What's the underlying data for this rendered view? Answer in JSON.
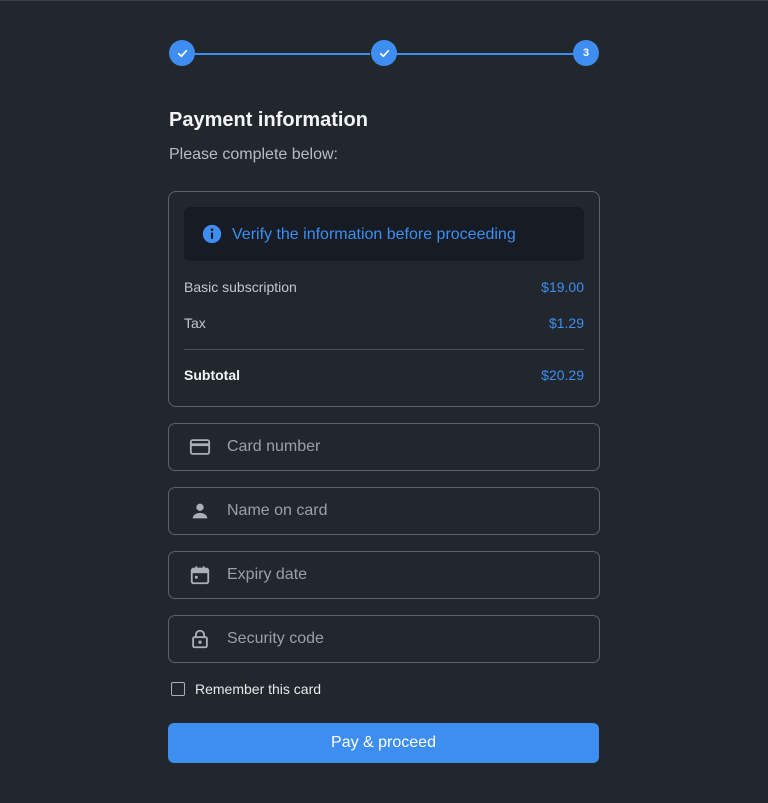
{
  "stepper": {
    "steps": [
      {
        "state": "complete",
        "icon": "check-icon"
      },
      {
        "state": "complete",
        "icon": "check-icon"
      },
      {
        "state": "current",
        "label": "3"
      }
    ]
  },
  "title": "Payment information",
  "subtitle": "Please complete below:",
  "alert": {
    "icon": "info-icon",
    "text": "Verify the information before proceeding"
  },
  "summary": {
    "rows": [
      {
        "label": "Basic subscription",
        "amount": "$19.00"
      },
      {
        "label": "Tax",
        "amount": "$1.29"
      }
    ],
    "subtotal": {
      "label": "Subtotal",
      "amount": "$20.29"
    }
  },
  "fields": {
    "card_number": {
      "icon": "credit-card-icon",
      "placeholder": "Card number",
      "value": ""
    },
    "name_on_card": {
      "icon": "person-icon",
      "placeholder": "Name on card",
      "value": ""
    },
    "expiry_date": {
      "icon": "calendar-icon",
      "placeholder": "Expiry date",
      "value": ""
    },
    "security_code": {
      "icon": "lock-icon",
      "placeholder": "Security code",
      "value": ""
    }
  },
  "remember": {
    "label": "Remember this card",
    "checked": false
  },
  "pay_button": {
    "label": "Pay & proceed"
  },
  "colors": {
    "background": "#22272e",
    "accent": "#3d8ef0",
    "border": "#5b616b",
    "alert_background": "#161b24"
  }
}
